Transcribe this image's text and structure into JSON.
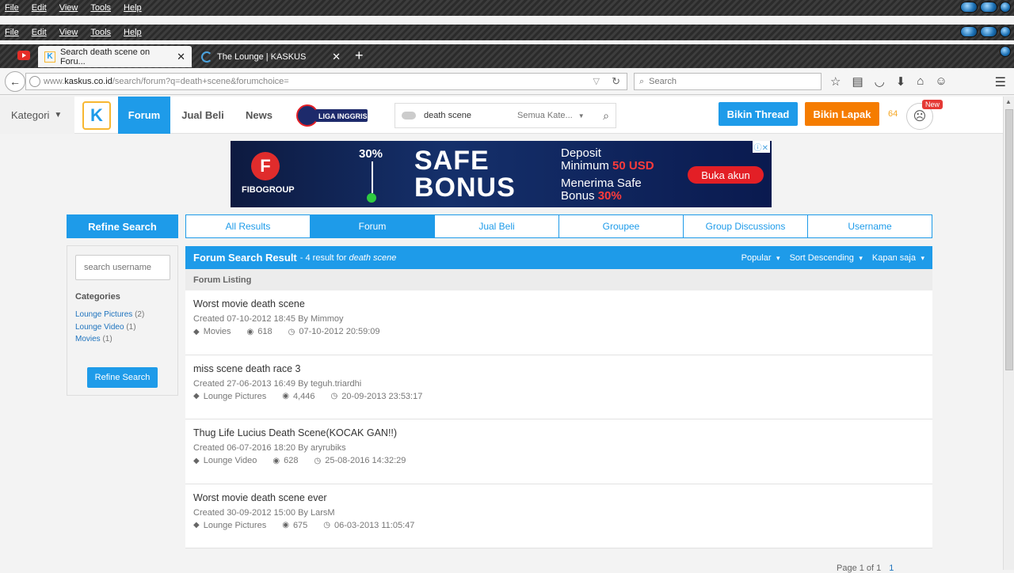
{
  "menubar": {
    "items": [
      "File",
      "Edit",
      "View",
      "Tools",
      "Help"
    ]
  },
  "tabs": [
    {
      "title": "Search death scene on Foru...",
      "close": "✕"
    },
    {
      "title": "The Lounge | KASKUS",
      "close": "✕"
    }
  ],
  "newtab": "+",
  "url": {
    "prefix": "www.",
    "host": "kaskus.co.id",
    "path": "/search/forum?q=death+scene&forumchoice="
  },
  "browser_search": {
    "placeholder": "Search"
  },
  "header": {
    "kategori": "Kategori",
    "logo": "K",
    "nav": [
      "Forum",
      "Jual Beli",
      "News"
    ],
    "liga": "LIGA INGGRIS",
    "search_value": "death scene",
    "search_category": "Semua Kate...",
    "bikin_thread": "Bikin Thread",
    "bikin_lapak": "Bikin Lapak",
    "notif_count": "64",
    "new_badge": "New"
  },
  "ad": {
    "brand": "FIBOGROUP",
    "brand_letter": "F",
    "percent": "30%",
    "headline": [
      "SAFE",
      "BONUS"
    ],
    "deposit_line1": "Deposit",
    "deposit_line2a": "Minimum ",
    "deposit_line2b": "50 USD",
    "bonus_line1": "Menerima Safe",
    "bonus_line2a": "Bonus ",
    "bonus_line2b": "30%",
    "cta": "Buka akun",
    "close": "ⓘ✕"
  },
  "sidebar": {
    "head": "Refine Search",
    "username_placeholder": "search username",
    "categories_label": "Categories",
    "categories": [
      {
        "name": "Lounge Pictures",
        "count": "(2)"
      },
      {
        "name": "Lounge Video",
        "count": "(1)"
      },
      {
        "name": "Movies",
        "count": "(1)"
      }
    ],
    "button": "Refine Search"
  },
  "result_tabs": [
    "All Results",
    "Forum",
    "Jual Beli",
    "Groupee",
    "Group Discussions",
    "Username"
  ],
  "result_bar": {
    "title": "Forum Search Result",
    "sub": "- 4 result for",
    "query": "death scene",
    "sorts": [
      "Popular",
      "Sort Descending",
      "Kapan saja"
    ]
  },
  "listing_head": "Forum Listing",
  "results": [
    {
      "title": "Worst movie death scene",
      "created": "Created 07-10-2012 18:45 By Mimmoy",
      "category": "Movies",
      "views": "618",
      "last": "07-10-2012 20:59:09"
    },
    {
      "title": "miss scene death race 3",
      "created": "Created 27-06-2013 16:49 By teguh.triardhi",
      "category": "Lounge Pictures",
      "views": "4,446",
      "last": "20-09-2013 23:53:17"
    },
    {
      "title": "Thug Life Lucius Death Scene(KOCAK GAN!!)",
      "created": "Created 06-07-2016 18:20 By aryrubiks",
      "category": "Lounge Video",
      "views": "628",
      "last": "25-08-2016 14:32:29"
    },
    {
      "title": "Worst movie death scene ever",
      "created": "Created 30-09-2012 15:00 By LarsM",
      "category": "Lounge Pictures",
      "views": "675",
      "last": "06-03-2013 11:05:47"
    }
  ],
  "pager": {
    "text": "Page 1 of 1",
    "current": "1"
  },
  "colors": {
    "primary": "#1e9be9",
    "orange": "#f57c00"
  }
}
